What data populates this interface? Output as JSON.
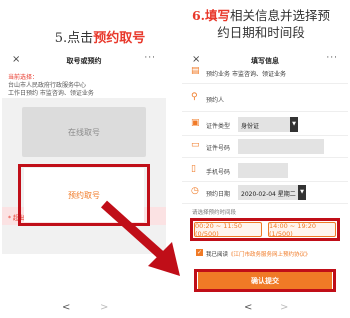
{
  "left": {
    "caption_pre": "5.点击",
    "caption_hl": "预约取号",
    "title": "取号或预约",
    "selected_label": "当前选择：",
    "selected_line_1": "台山市人民政府行政服务中心",
    "selected_line_2": "工作日预约   市监咨询、领证业务",
    "online_button": "在线取号",
    "appointment_button": "预约取号",
    "warning": "* 超出取号范围!"
  },
  "right": {
    "caption_hl": "6.填写",
    "caption_rest": "相关信息并选择预约日期和时间段",
    "title": "填写信息",
    "business_label": "预约业务",
    "business_value": "市监咨询、领证业务",
    "person_label": "预约人",
    "doc_type_label": "证件类型",
    "doc_type_value": "身份证",
    "doc_no_label": "证件号码",
    "phone_label": "手机号码",
    "date_label": "预约日期",
    "date_value": "2020-02-04 星期二",
    "time_label": "请选择预约时间段",
    "slot_1": "00:20 ~ 11:50 (0/500)",
    "slot_2": "14:00 ~ 19:20 (1/500)",
    "agree_text": "我已阅读",
    "agree_link": "《江门市政务服务网上预约协议》",
    "submit_label": "确认提交"
  },
  "nav": {
    "back": "<",
    "forward": ">"
  },
  "icons": {
    "close": "close-icon",
    "more": "more-icon",
    "person": "person-icon",
    "id-card": "id-card-icon",
    "phone": "phone-icon",
    "calendar": "calendar-icon",
    "arrow": "red-arrow"
  },
  "colors": {
    "highlight": "#e8382b",
    "accent": "#f07a26",
    "frame": "#c00e18",
    "warning_bg": "#fbe2e3"
  }
}
